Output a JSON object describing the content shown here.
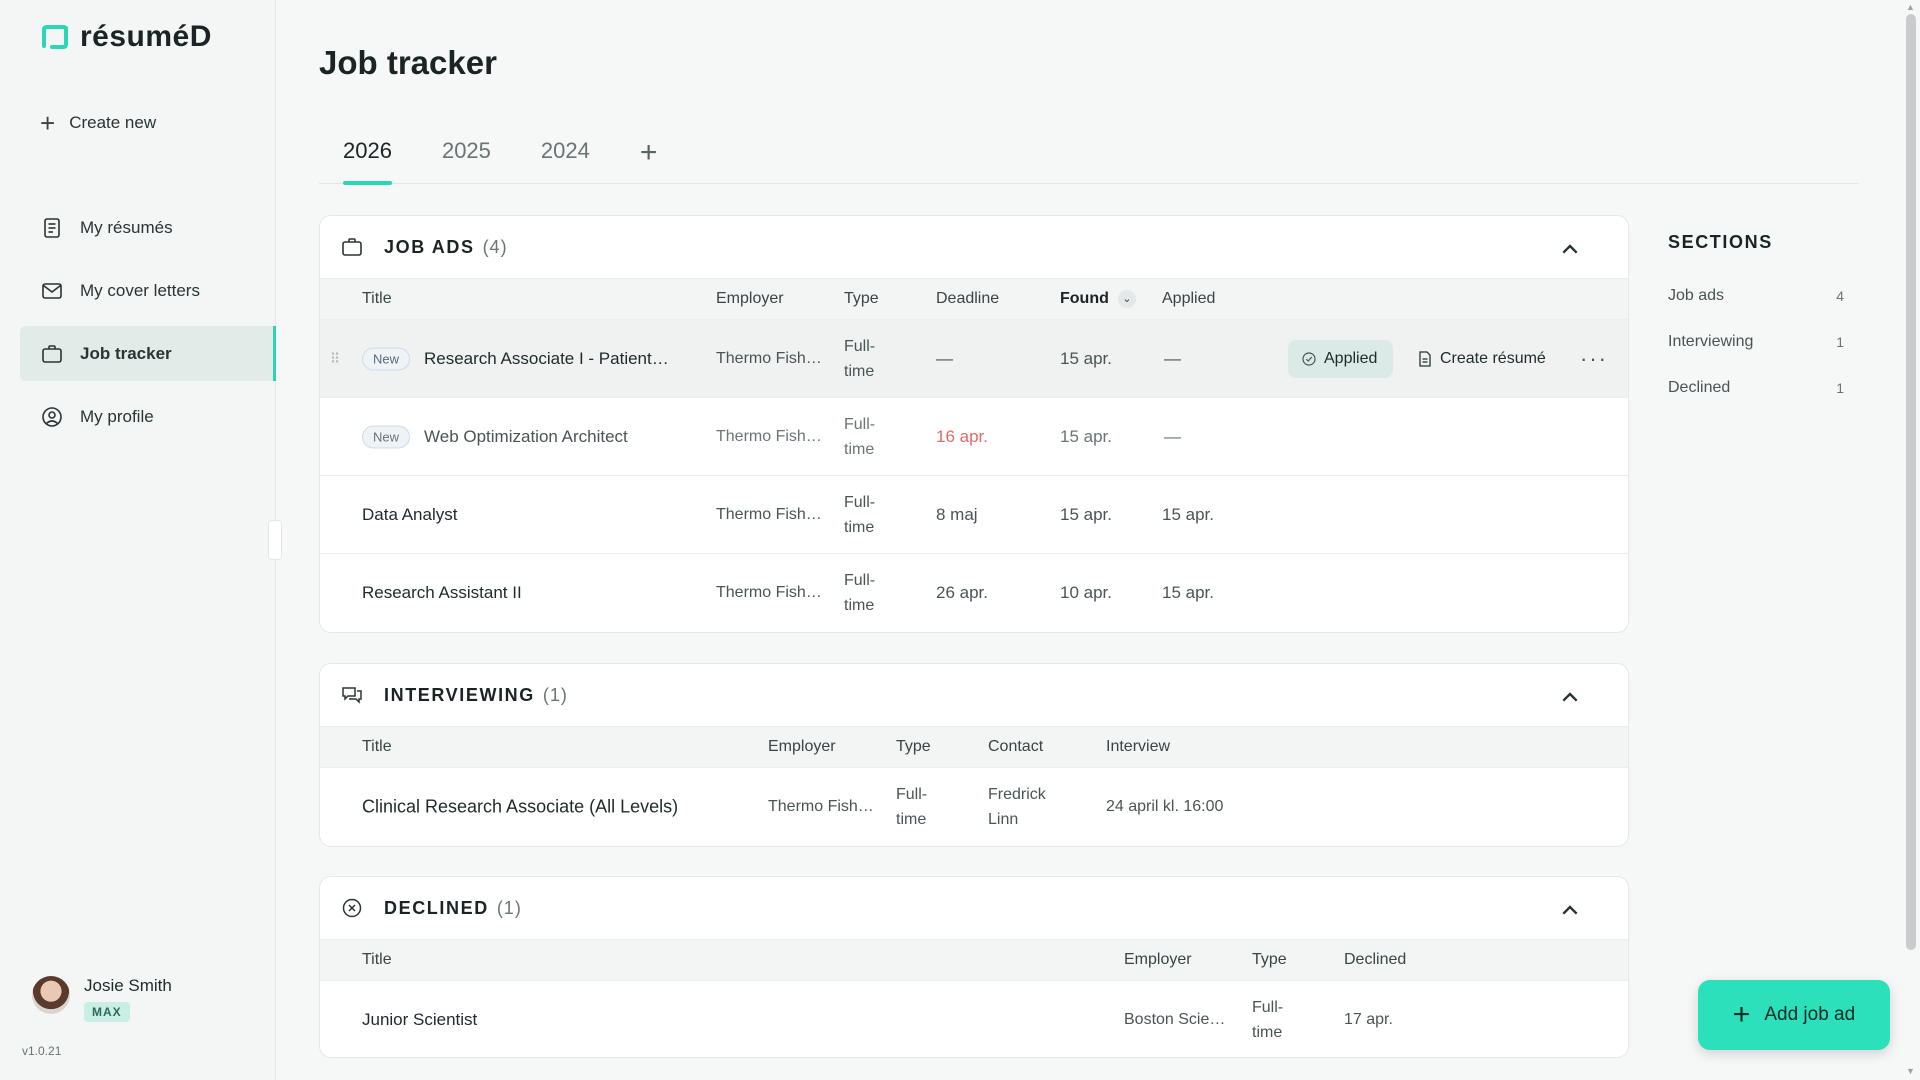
{
  "app": {
    "logo_text": "résuméD",
    "version": "v1.0.21",
    "accent": "#2bd6b4"
  },
  "sidebar": {
    "create_new": "Create new",
    "items": [
      {
        "label": "My résumés",
        "icon": "document-icon"
      },
      {
        "label": "My cover letters",
        "icon": "mail-icon"
      },
      {
        "label": "Job tracker",
        "icon": "briefcase-icon",
        "active": true
      },
      {
        "label": "My profile",
        "icon": "user-circle-icon"
      }
    ],
    "user": {
      "name": "Josie Smith",
      "plan": "MAX"
    }
  },
  "page": {
    "title": "Job tracker"
  },
  "tabs": [
    "2026",
    "2025",
    "2024"
  ],
  "job_ads": {
    "title": "JOB ADS",
    "count": "(4)",
    "columns": {
      "title": "Title",
      "employer": "Employer",
      "type": "Type",
      "deadline": "Deadline",
      "found": "Found",
      "applied": "Applied"
    },
    "rows": [
      {
        "tag": "New",
        "title": "Research Associate I - Patient…",
        "employer": "Thermo Fish…",
        "type1": "Full-",
        "type2": "time",
        "deadline": "—",
        "found": "15 apr.",
        "applied": "—"
      },
      {
        "tag": "New",
        "title": "Web Optimization Architect",
        "employer": "Thermo Fish…",
        "type1": "Full-",
        "type2": "time",
        "deadline": "16 apr.",
        "found": "15 apr.",
        "applied": "—"
      },
      {
        "tag": "",
        "title": "Data Analyst",
        "employer": "Thermo Fish…",
        "type1": "Full-",
        "type2": "time",
        "deadline": "8 maj",
        "found": "15 apr.",
        "applied": "15 apr."
      },
      {
        "tag": "",
        "title": "Research Assistant II",
        "employer": "Thermo Fish…",
        "type1": "Full-",
        "type2": "time",
        "deadline": "26 apr.",
        "found": "10 apr.",
        "applied": "15 apr."
      }
    ],
    "actions": {
      "applied": "Applied",
      "create_resume": "Create résumé",
      "more": "···"
    }
  },
  "interviewing": {
    "title": "INTERVIEWING",
    "count": "(1)",
    "columns": {
      "title": "Title",
      "employer": "Employer",
      "type": "Type",
      "contact": "Contact",
      "interview": "Interview"
    },
    "rows": [
      {
        "title": "Clinical Research Associate (All Levels)",
        "employer": "Thermo Fish…",
        "type1": "Full-",
        "type2": "time",
        "contact1": "Fredrick",
        "contact2": "Linn",
        "interview": "24 april kl. 16:00"
      }
    ]
  },
  "declined": {
    "title": "DECLINED",
    "count": "(1)",
    "columns": {
      "title": "Title",
      "employer": "Employer",
      "type": "Type",
      "declined": "Declined"
    },
    "rows": [
      {
        "title": "Junior Scientist",
        "employer": "Boston Scie…",
        "type1": "Full-",
        "type2": "time",
        "declined": "17 apr."
      }
    ]
  },
  "sections_panel": {
    "title": "SECTIONS",
    "items": [
      {
        "label": "Job ads",
        "count": "4"
      },
      {
        "label": "Interviewing",
        "count": "1"
      },
      {
        "label": "Declined",
        "count": "1"
      }
    ]
  },
  "add_button": "Add job ad"
}
